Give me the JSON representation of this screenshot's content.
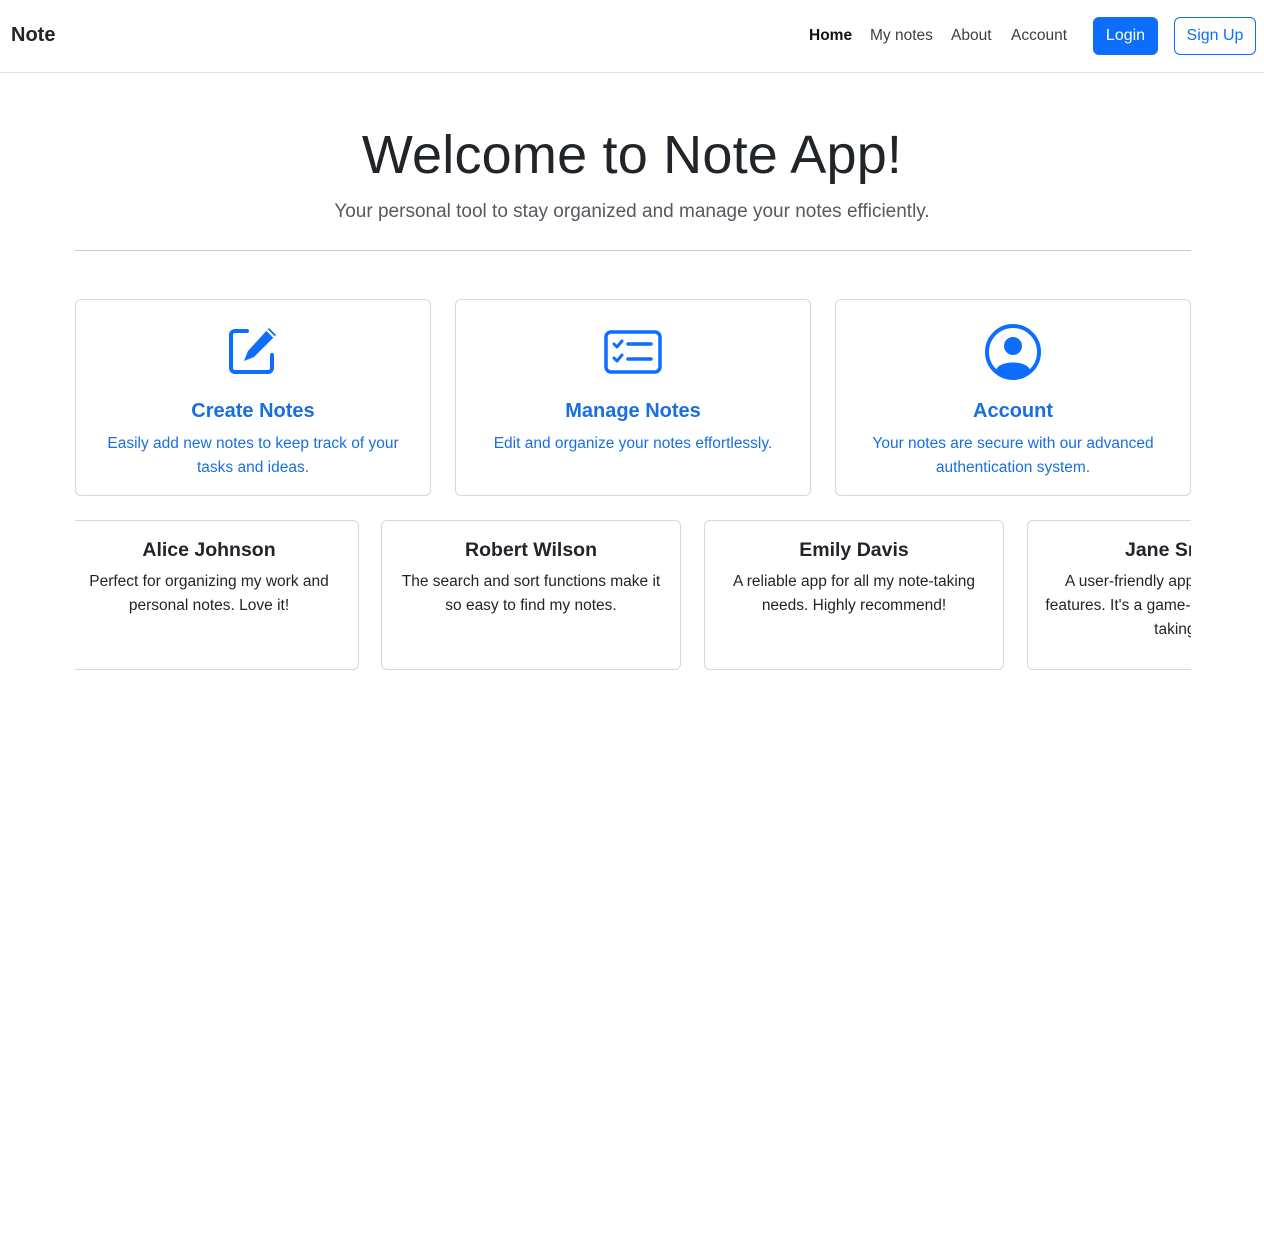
{
  "navbar": {
    "brand": "Note",
    "links": [
      {
        "label": "Home",
        "active": true
      },
      {
        "label": "My notes"
      },
      {
        "label": "About"
      },
      {
        "label": "Account"
      }
    ],
    "login_label": "Login",
    "signup_label": "Sign Up"
  },
  "hero": {
    "title": "Welcome to Note App!",
    "subtitle": "Your personal tool to stay organized and manage your notes efficiently."
  },
  "features": [
    {
      "icon": "pencil-square-icon",
      "title": "Create Notes",
      "description": "Easily add new notes to keep track of your tasks and ideas."
    },
    {
      "icon": "checklist-card-icon",
      "title": "Manage Notes",
      "description": "Edit and organize your notes effortlessly."
    },
    {
      "icon": "user-circle-icon",
      "title": "Account",
      "description": "Your notes are secure with our advanced authentication system."
    }
  ],
  "testimonials": [
    {
      "name": "Alice Johnson",
      "text": "Perfect for organizing my work and personal notes. Love it!"
    },
    {
      "name": "Robert Wilson",
      "text": "The search and sort functions make it so easy to find my notes."
    },
    {
      "name": "Emily Davis",
      "text": "A reliable app for all my note-taking needs. Highly recommend!"
    },
    {
      "name": "Jane Smith",
      "text": "A user-friendly app with amazing features. It's a game-changer for note-taking."
    }
  ],
  "colors": {
    "primary": "#0d6efd",
    "text": "#212529",
    "border": "#dee2e6"
  }
}
